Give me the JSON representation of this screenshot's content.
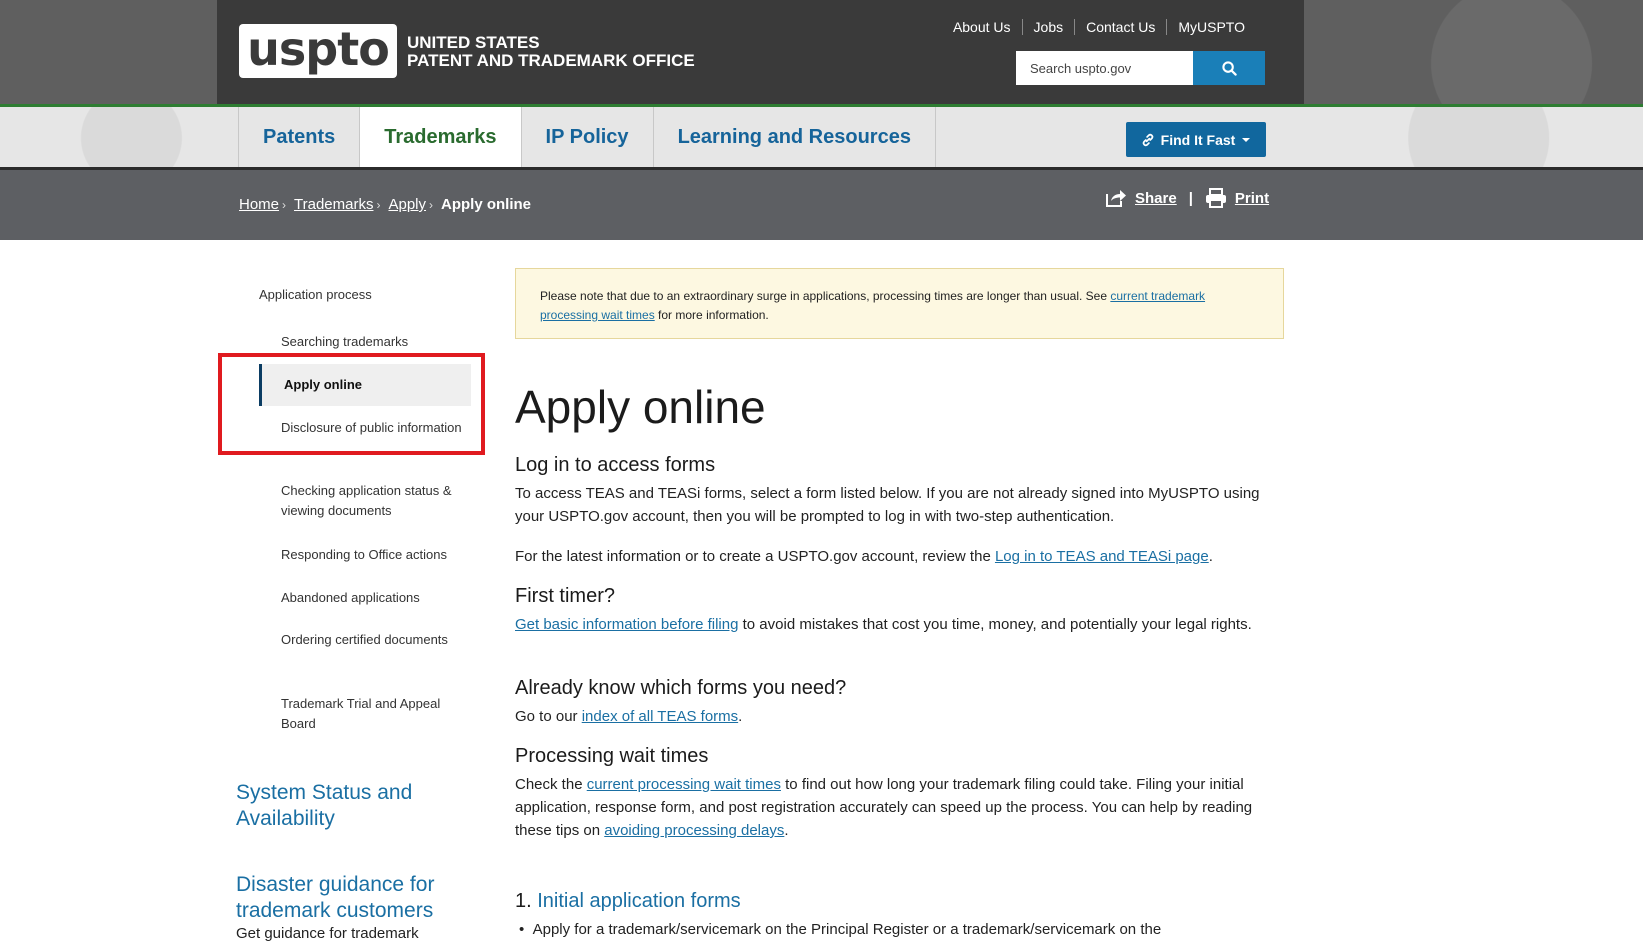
{
  "header": {
    "logo_text": "uspto",
    "agency_line1": "UNITED STATES",
    "agency_line2": "PATENT AND TRADEMARK OFFICE",
    "util_links": [
      "About Us",
      "Jobs",
      "Contact Us",
      "MyUSPTO"
    ],
    "search_placeholder": "Search uspto.gov"
  },
  "nav": {
    "items": [
      "Patents",
      "Trademarks",
      "IP Policy",
      "Learning and Resources"
    ],
    "active": "Trademarks",
    "find_it_fast": "Find It Fast"
  },
  "breadcrumb": {
    "items": [
      "Home",
      "Trademarks",
      "Apply"
    ],
    "current": "Apply online",
    "share": "Share",
    "print": "Print"
  },
  "sidebar": {
    "section_title": "Application process",
    "items": [
      "Searching trademarks",
      "Apply online",
      "Disclosure of public information",
      "Checking application status & viewing documents",
      "Responding to Office actions",
      "Abandoned applications",
      "Ordering certified documents",
      "Trademark Trial and Appeal Board"
    ],
    "headings": [
      "System Status and Availability",
      "Disaster guidance for trademark customers"
    ],
    "sub_text": "Get guidance for trademark"
  },
  "notice": {
    "text_before": "Please note that due to an extraordinary surge in applications, processing times are longer than usual. See ",
    "link": "current trademark processing wait times",
    "text_after": " for more information."
  },
  "main": {
    "title": "Apply online",
    "sections": {
      "login_heading": "Log in to access forms",
      "login_p1": "To access TEAS and TEASi forms, select a form listed below. If you are not already signed into MyUSPTO using your USPTO.gov account, then you will be prompted to log in with two-step authentication.",
      "login_p2_before": "For the latest information or to create a USPTO.gov account, review the ",
      "login_p2_link": "Log in to TEAS and TEASi page",
      "login_p2_after": ".",
      "first_timer_heading": "First timer?",
      "first_timer_link": "Get basic information before filing",
      "first_timer_after": " to avoid mistakes that cost you time, money, and potentially your legal rights.",
      "know_heading": "Already know which forms you need?",
      "know_before": "Go to our ",
      "know_link": "index of all TEAS forms",
      "know_after": ".",
      "wait_heading": "Processing wait times",
      "wait_before": "Check the ",
      "wait_link1": "current processing wait times",
      "wait_mid": " to find out how long your trademark filing could take. Filing your initial application, response form, and post registration accurately can speed up the process. You can help by reading these tips on ",
      "wait_link2": "avoiding processing delays",
      "wait_after": ".",
      "initial_num": "1. ",
      "initial_link": "Initial application forms",
      "bullet_text": "Apply for a trademark/servicemark on the Principal Register or a trademark/servicemark on the"
    }
  },
  "colors": {
    "header_bg": "#3a3a3a",
    "link_blue": "#1a6fa3",
    "active_nav_green": "#2a6b2f",
    "highlight_red": "#e01a1f",
    "button_blue": "#11679e"
  }
}
